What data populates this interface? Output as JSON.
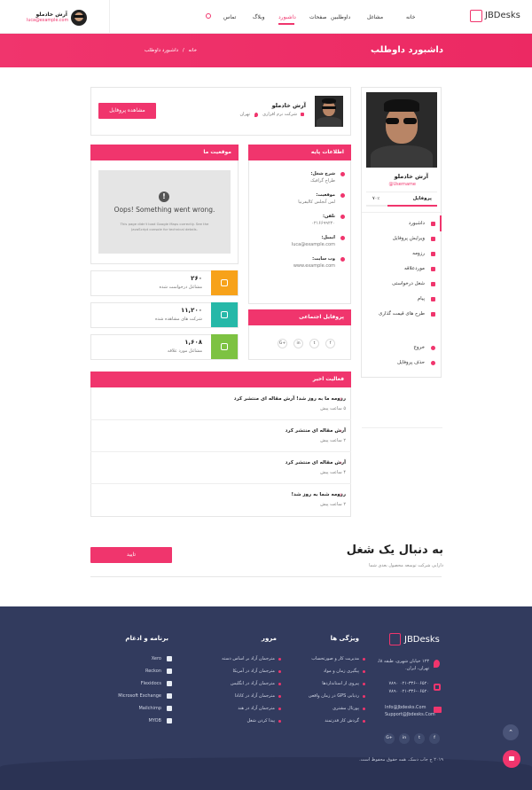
{
  "header": {
    "brand": "JBDesks",
    "nav": [
      "خانه",
      "مشاغل",
      "داوطلبین",
      "صفحات",
      "داشبورد",
      "وبلاگ",
      "تماس"
    ],
    "user_name": "آرش خادملو",
    "user_email": "luca@example.com"
  },
  "banner": {
    "title": "داشبورد داوطلب",
    "breadcrumb_home": "خانه",
    "breadcrumb_sep": "/",
    "breadcrumb_current": "داشبورد داوطلب"
  },
  "sidebar": {
    "name": "آرش خادملو",
    "username": "Username@",
    "profile_label": "پروفایل",
    "profile_pct": "۷۰٪",
    "progress": 0.7,
    "menu": [
      {
        "label": "داشبورد",
        "icon": "dashboard-icon"
      },
      {
        "label": "ویرایش پروفایل",
        "icon": "edit-icon"
      },
      {
        "label": "رزومه",
        "icon": "resume-icon"
      },
      {
        "label": "موردعلاقه",
        "icon": "heart-icon"
      },
      {
        "label": "شغل درخواستی",
        "icon": "check-icon"
      },
      {
        "label": "پیام",
        "icon": "message-icon"
      },
      {
        "label": "طرح های قیمت گذاری",
        "icon": "tag-icon"
      }
    ],
    "logout": "خروج",
    "delete": "حذف پروفایل"
  },
  "profile_card": {
    "name": "آرش خادملو",
    "company": "شرکت نرم افزاری",
    "city": "تهران",
    "view_button": "مشاهده پروفایل"
  },
  "basic_info": {
    "title": "اطلاعات پایه",
    "items": [
      {
        "label": "شرح شغل:",
        "value": "طراح گرافیک"
      },
      {
        "label": "موقعیت:",
        "value": "لس آنجلس کالیفرنیا"
      },
      {
        "label": "تلفن:",
        "value": "۰۲۱۶۶۹۹۲۲۰"
      },
      {
        "label": "ایمیل:",
        "value": "luca@example.com"
      },
      {
        "label": "وب سایت:",
        "value": "www.example.com"
      }
    ]
  },
  "location": {
    "title": "موقعیت ما",
    "error_title": "Oops! Something went wrong.",
    "error_line1": "This page didn't load Google Maps correctly. See the",
    "error_line2": "JavaScript console for technical details."
  },
  "social": {
    "title": "پروفایل اجتماعی",
    "icons": [
      "f",
      "t",
      "in",
      "G+"
    ]
  },
  "stats": [
    {
      "value": "۲۶۰",
      "label": "مشاغل درخواست شده",
      "color": "#f7a21a"
    },
    {
      "value": "۱۱,۲۰۰",
      "label": "شرکت های مشاهده شده",
      "color": "#26b8a8"
    },
    {
      "value": "۱,۶۰۸",
      "label": "مشاغل مورد علاقه",
      "color": "#7dc242"
    }
  ],
  "activity": {
    "title": "فعالیت اخیر",
    "items": [
      {
        "text": "رزومه ما به روز شد! آرش مقاله ای منتشر کرد",
        "time": "۵ ساعت پیش"
      },
      {
        "text": "آرش مقاله ای منتشر کرد",
        "time": "۲ ساعت پیش"
      },
      {
        "text": "آرش مقاله ای منتشر کرد",
        "time": "۴ ساعت پیش"
      },
      {
        "text": "رزومه شما به روز شد!",
        "time": "۲ ساعت پیش"
      }
    ]
  },
  "job_search": {
    "title": "به دنبال یک شغل",
    "subtitle": "دارایی شرکت توسعه محصول بعدی شما",
    "button": "تایید"
  },
  "footer": {
    "brand": "JBDesks",
    "address": "۱۲۳ خیابان شهری، طبقه ۸ا، تهران، ایران.",
    "phone1": "۰۲۱-۳۳۶-۰۶۵۲۰ ۷۸۹۰",
    "phone2": "۰۲۱-۳۳۶-۰۶۵۲۰ ۷۸۹۰",
    "email1": "Info@Jbdesks.Com",
    "email2": "Support@Jbdesks.Com",
    "social": [
      "f",
      "t",
      "in",
      "G+"
    ],
    "features_title": "ویژگی ها",
    "features": [
      "مدیریت کار و صورتحساب",
      "پیگیری زمان و مواد",
      "پیروی از استانداردها",
      "ردیابی GPS در زمان واقعی",
      "پورتال مشتری",
      "گردش کار قدرتمند"
    ],
    "browse_title": "مرور",
    "browse": [
      "مترجمان آزاد بر اساس دسته",
      "مترجمان آزاد در آمریکا",
      "مترجمان آزاد در انگلیس",
      "مترجمان آزاد در کانادا",
      "مترجمان آزاد در هند",
      "پیدا کردن شغل"
    ],
    "apps_title": "برنامه و ادغام",
    "apps": [
      "Xero",
      "Reckon",
      "Flexidocs",
      "Microsoft Exchange",
      "Mailchimp",
      "MYOB"
    ],
    "copyright": "۲۰۱۹ ج جاب دسک. همه حقوق محفوظ است."
  },
  "colors": {
    "accent": "#f0356d",
    "footer_bg": "#323b5e"
  }
}
